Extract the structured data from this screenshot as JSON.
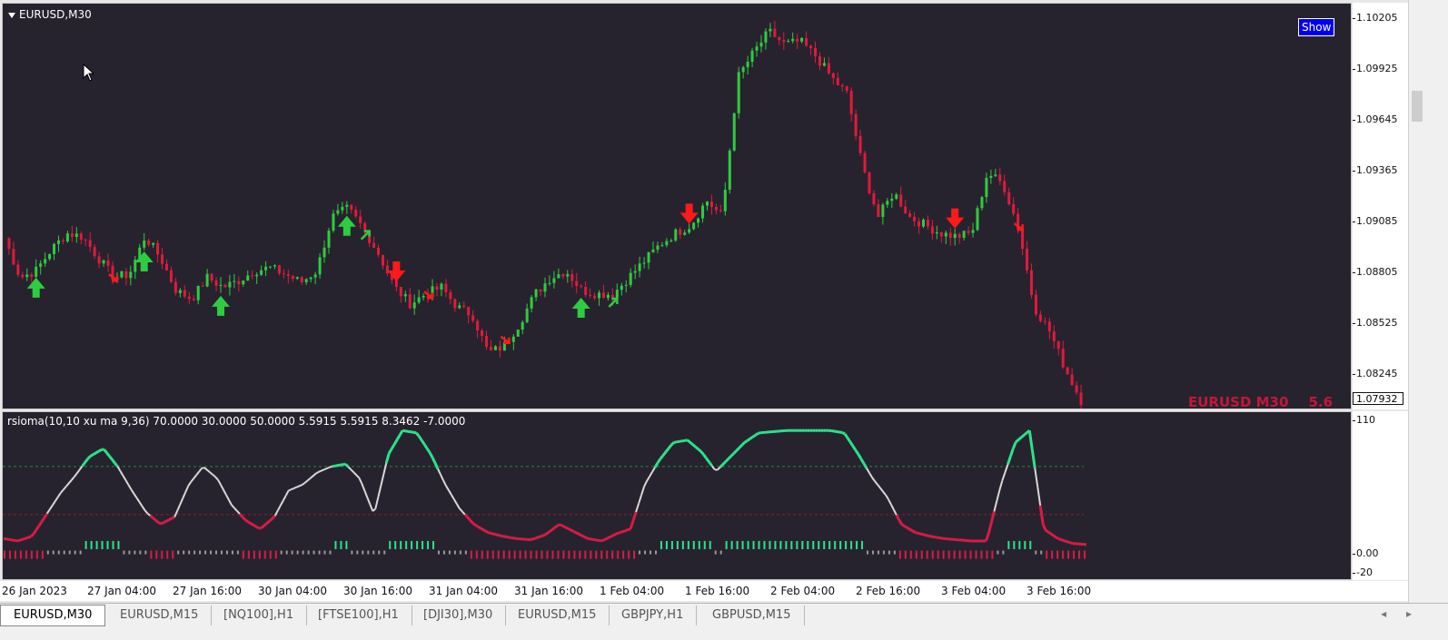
{
  "chart": {
    "symbol_label": "EURUSD,M30",
    "show_button": "Show",
    "watermark_symbol": "EURUSD M30",
    "watermark_value": "5.6",
    "current_price": "1.07932",
    "price_ticks": [
      "1.10205",
      "1.09925",
      "1.09645",
      "1.09365",
      "1.09085",
      "1.08805",
      "1.08525",
      "1.08245",
      "1.07965"
    ],
    "indicator_label": "rsioma(10,10 xu ma 9,36) 70.0000 30.0000 50.0000 5.5915 5.5915 8.3462 -7.0000",
    "indicator_ticks": [
      "110",
      "0.00",
      "-20"
    ],
    "time_ticks": [
      "26 Jan 2023",
      "27 Jan 04:00",
      "27 Jan 16:00",
      "30 Jan 04:00",
      "30 Jan 16:00",
      "31 Jan 04:00",
      "31 Jan 16:00",
      "1 Feb 04:00",
      "1 Feb 16:00",
      "2 Feb 04:00",
      "2 Feb 16:00",
      "3 Feb 04:00",
      "3 Feb 16:00"
    ],
    "colors": {
      "background": "#27232e",
      "bull": "#2ecc40",
      "bear": "#e01a3c",
      "arrow_up": "#2ecc40",
      "arrow_down": "#ff1a1a",
      "rsi_high": "#2be38b",
      "rsi_mid": "#d8d8d8",
      "rsi_low": "#d81b46",
      "hist_neutral": "#9a9a9a"
    }
  },
  "chart_data": {
    "type": "candlestick",
    "close_path": [
      1.0892,
      1.0868,
      1.0872,
      1.0885,
      1.0895,
      1.0893,
      1.088,
      1.0868,
      1.087,
      1.0893,
      1.088,
      1.086,
      1.0855,
      1.0868,
      1.0862,
      1.0866,
      1.0872,
      1.0874,
      1.087,
      1.0865,
      1.0872,
      1.0905,
      1.091,
      1.0898,
      1.0882,
      1.0862,
      1.0852,
      1.0858,
      1.0862,
      1.085,
      1.0845,
      1.0822,
      1.0826,
      1.084,
      1.0858,
      1.0868,
      1.0872,
      1.086,
      1.0858,
      1.0858,
      1.0868,
      1.0878,
      1.0888,
      1.0895,
      1.09,
      1.0915,
      1.0905,
      1.099,
      1.1005,
      1.1018,
      1.101,
      1.1012,
      1.1003,
      1.099,
      1.098,
      1.0935,
      1.0905,
      1.092,
      1.0905,
      1.09,
      1.0895,
      1.0893,
      1.0895,
      1.0932,
      1.0925,
      1.0898,
      1.085,
      1.0835,
      1.0812,
      1.0793
    ],
    "arrows_up": [
      2,
      9,
      14,
      22,
      37,
      75
    ],
    "arrows_down": [
      25,
      44,
      61,
      78
    ],
    "small_up": [
      23,
      39,
      71
    ],
    "small_down": [
      7,
      27,
      32,
      65,
      80
    ],
    "rsi_path": [
      10,
      8,
      12,
      30,
      48,
      62,
      78,
      85,
      70,
      50,
      32,
      22,
      28,
      55,
      70,
      60,
      38,
      25,
      18,
      28,
      50,
      55,
      65,
      70,
      72,
      60,
      30,
      80,
      100,
      98,
      80,
      55,
      35,
      22,
      15,
      12,
      10,
      9,
      13,
      22,
      16,
      10,
      8,
      14,
      18,
      55,
      75,
      90,
      92,
      82,
      66,
      78,
      90,
      98,
      99,
      100,
      100,
      100,
      100,
      98,
      80,
      60,
      45,
      22,
      15,
      12,
      10,
      9,
      8,
      8,
      55,
      90,
      100,
      18,
      10,
      6,
      5
    ],
    "levels": [
      70,
      30,
      50
    ],
    "ylim": [
      -20,
      110
    ]
  },
  "tabs": [
    "EURUSD,M30",
    "EURUSD,M15",
    "[NQ100],H1",
    "[FTSE100],H1",
    "[DJI30],M30",
    "EURUSD,M15",
    "GBPJPY,H1",
    "GBPUSD,M15"
  ],
  "tab_nav": {
    "left": "◂",
    "right": "▸"
  }
}
